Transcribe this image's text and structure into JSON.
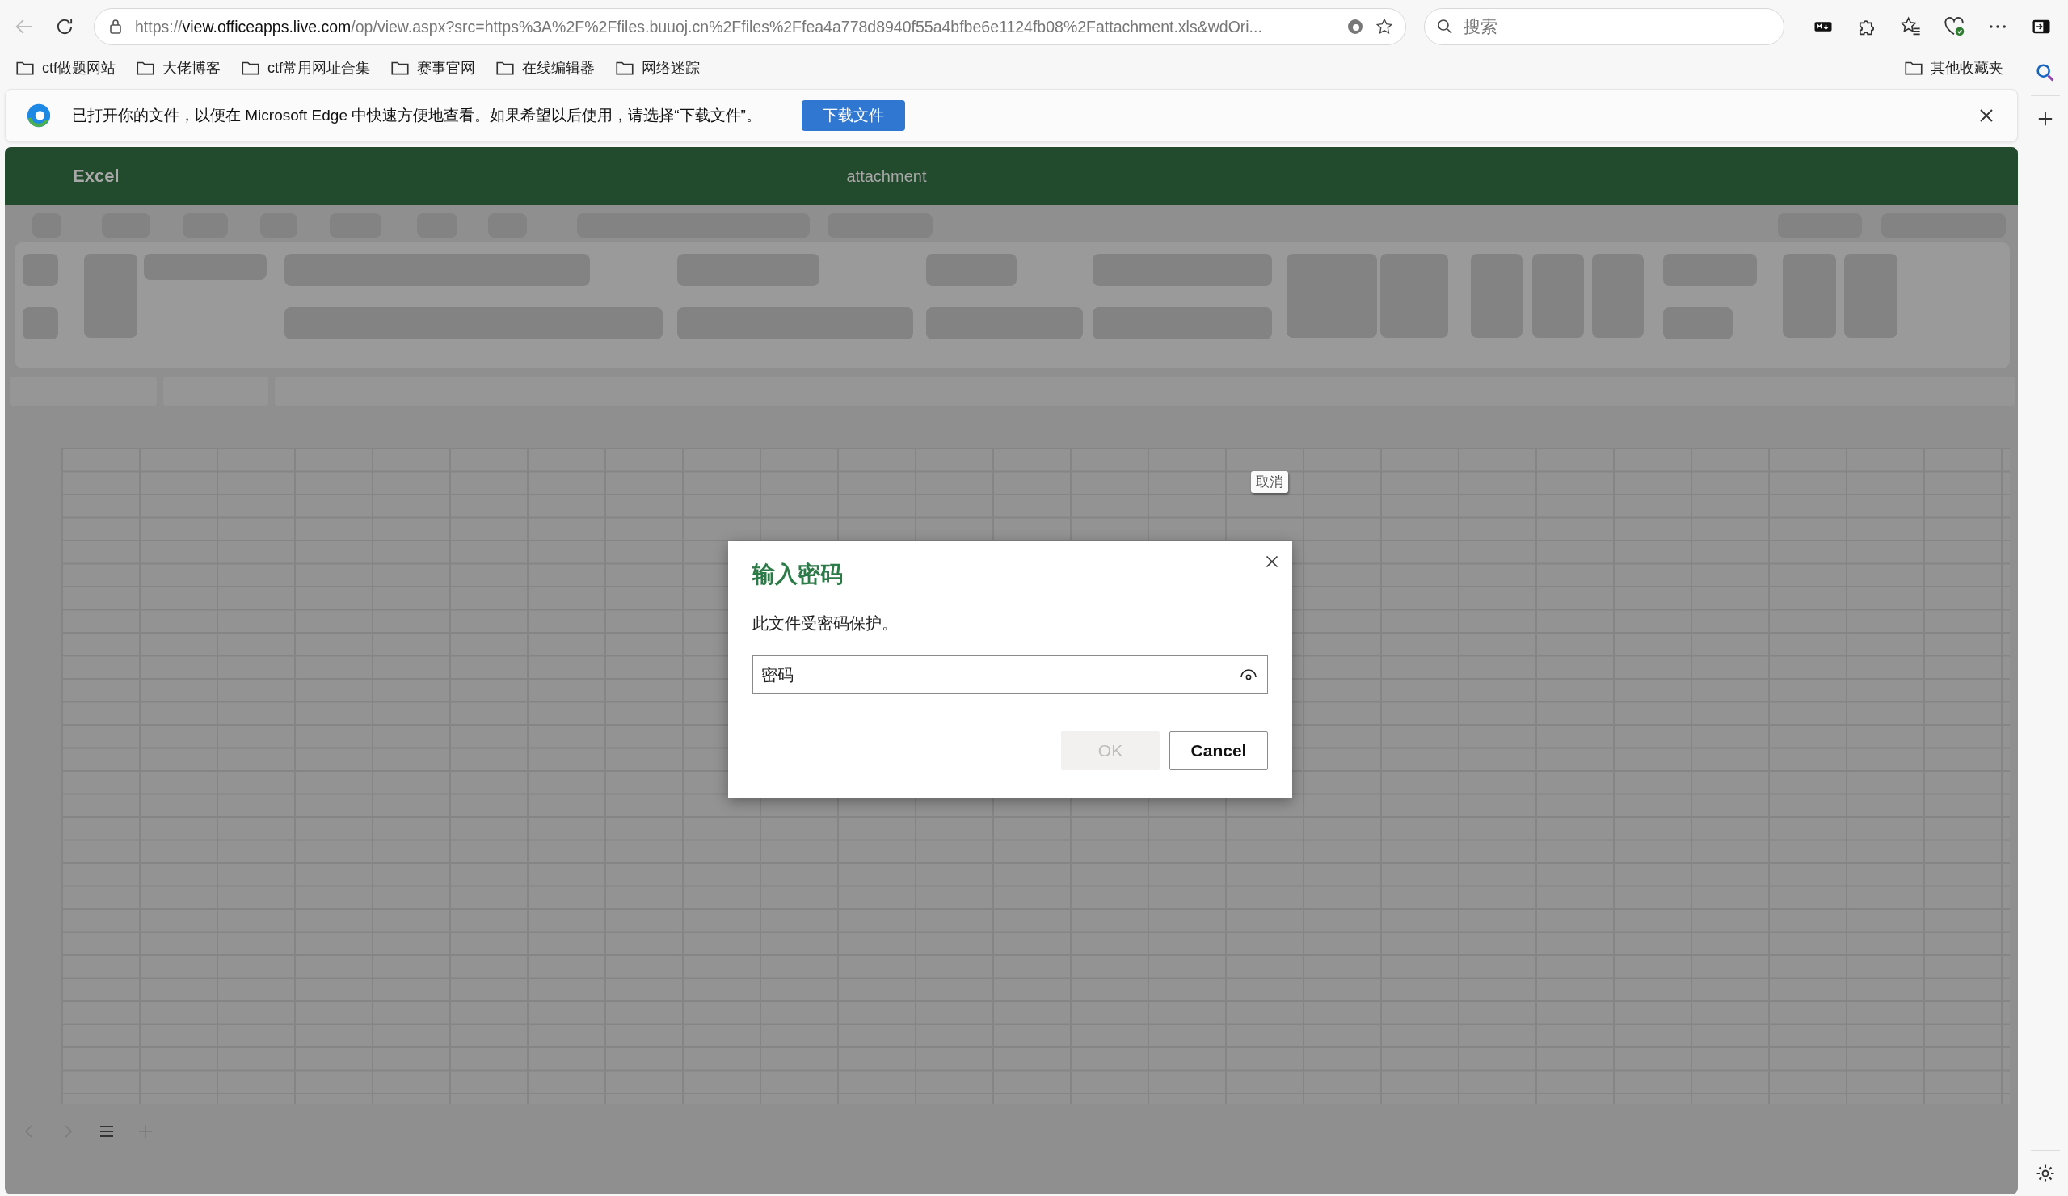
{
  "browser": {
    "url": "https://**view.officeapps.live.com**/op/view.aspx?src=https%3A%2F%2Ffiles.buuoj.cn%2Ffiles%2Ffea4a778d8940f55a4bfbe6e1124fb08%2Fattachment.xls&wdOri...",
    "search_placeholder": "搜索"
  },
  "bookmarks": [
    "ctf做题网站",
    "大佬博客",
    "ctf常用网址合集",
    "赛事官网",
    "在线编辑器",
    "网络迷踪"
  ],
  "other_bookmarks": "其他收藏夹",
  "infobar": {
    "message": "已打开你的文件，以便在 Microsoft Edge 中快速方便地查看。如果希望以后使用，请选择“下载文件”。",
    "button": "下载文件"
  },
  "app": {
    "name": "Excel",
    "document": "attachment"
  },
  "tooltip": "取消",
  "dialog": {
    "title": "输入密码",
    "message": "此文件受密码保护。",
    "field": {
      "placeholder": "密码"
    },
    "buttons": [
      {
        "label": "OK",
        "disabled": true
      },
      {
        "label": "Cancel",
        "disabled": false
      }
    ]
  }
}
